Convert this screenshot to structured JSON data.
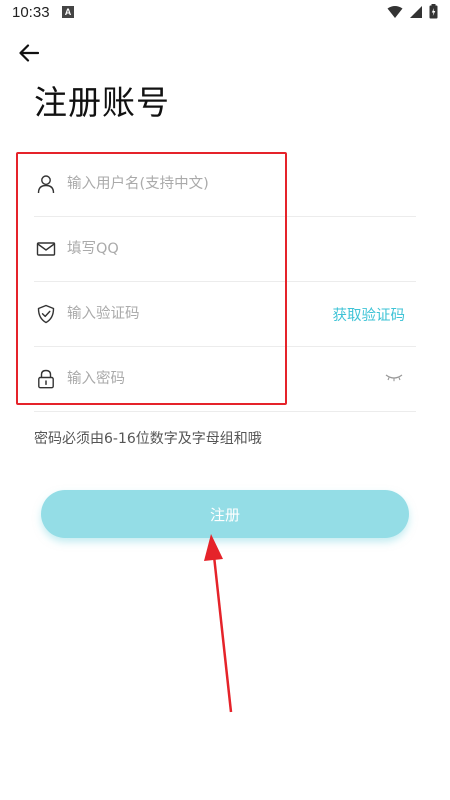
{
  "status_bar": {
    "time": "10:33",
    "notification_glyph": "A",
    "icons": [
      "wifi-icon",
      "signal-icon",
      "battery-icon"
    ]
  },
  "header": {
    "back_icon": "arrow-left-icon",
    "title": "注册账号"
  },
  "form": {
    "username": {
      "placeholder": "输入用户名(支持中文)",
      "icon": "user-icon",
      "value": ""
    },
    "qq": {
      "placeholder": "填写QQ",
      "icon": "mail-icon",
      "value": ""
    },
    "code": {
      "placeholder": "输入验证码",
      "icon": "shield-check-icon",
      "value": "",
      "action_label": "获取验证码"
    },
    "password": {
      "placeholder": "输入密码",
      "icon": "lock-icon",
      "value": "",
      "toggle_icon": "eye-closed-icon"
    }
  },
  "hint": "密码必须由6-16位数字及字母组和哦",
  "submit_label": "注册",
  "colors": {
    "accent": "#3ec3d6",
    "button_bg": "#94dde6",
    "annotation": "#e5232a"
  }
}
